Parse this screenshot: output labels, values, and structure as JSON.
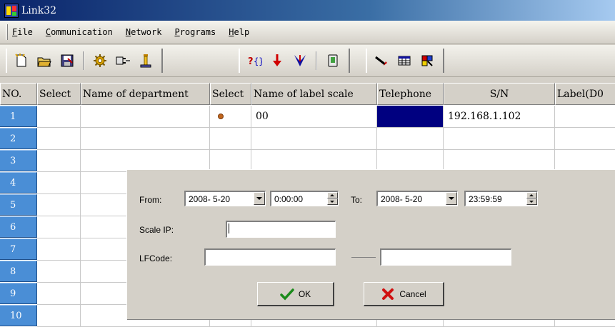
{
  "window": {
    "title": "Link32"
  },
  "menu": [
    {
      "key": "F",
      "rest": "ile"
    },
    {
      "key": "C",
      "rest": "ommunication"
    },
    {
      "key": "N",
      "rest": "etwork"
    },
    {
      "key": "P",
      "rest": "rograms"
    },
    {
      "key": "H",
      "rest": "elp"
    }
  ],
  "toolbar": {
    "icons": [
      "new-file-icon",
      "open-folder-icon",
      "save-icon",
      "settings-gear-icon",
      "connect-plug-icon",
      "scale-icon",
      "help-query-icon",
      "download-arrow-icon",
      "upload-merge-icon",
      "memory-card-icon",
      "pen-draw-icon",
      "table-icon",
      "color-palette-icon"
    ]
  },
  "grid": {
    "columns": [
      "NO.",
      "Select",
      "Name of department",
      "Select",
      "Name of label scale",
      "Telephone",
      "S/N",
      "Label(D0"
    ],
    "rows": [
      {
        "no": "1",
        "name_label_scale": "00",
        "sn": "192.168.1.102"
      },
      {
        "no": "2"
      },
      {
        "no": "3"
      },
      {
        "no": "4"
      },
      {
        "no": "5"
      },
      {
        "no": "6"
      },
      {
        "no": "7"
      },
      {
        "no": "8"
      },
      {
        "no": "9"
      },
      {
        "no": "10"
      }
    ]
  },
  "dialog": {
    "from_label": "From:",
    "from_date": "2008- 5-20",
    "from_time": "0:00:00",
    "to_label": "To:",
    "to_date": "2008- 5-20",
    "to_time": "23:59:59",
    "scale_ip_label": "Scale IP:",
    "scale_ip_value": "",
    "lfcode_label": "LFCode:",
    "lfcode_from": "",
    "lfcode_to": "",
    "ok_label": "OK",
    "cancel_label": "Cancel"
  },
  "colors": {
    "row_header": "#4a8ed6",
    "selected_cell": "#000080",
    "title_bar": "#0a246a"
  }
}
